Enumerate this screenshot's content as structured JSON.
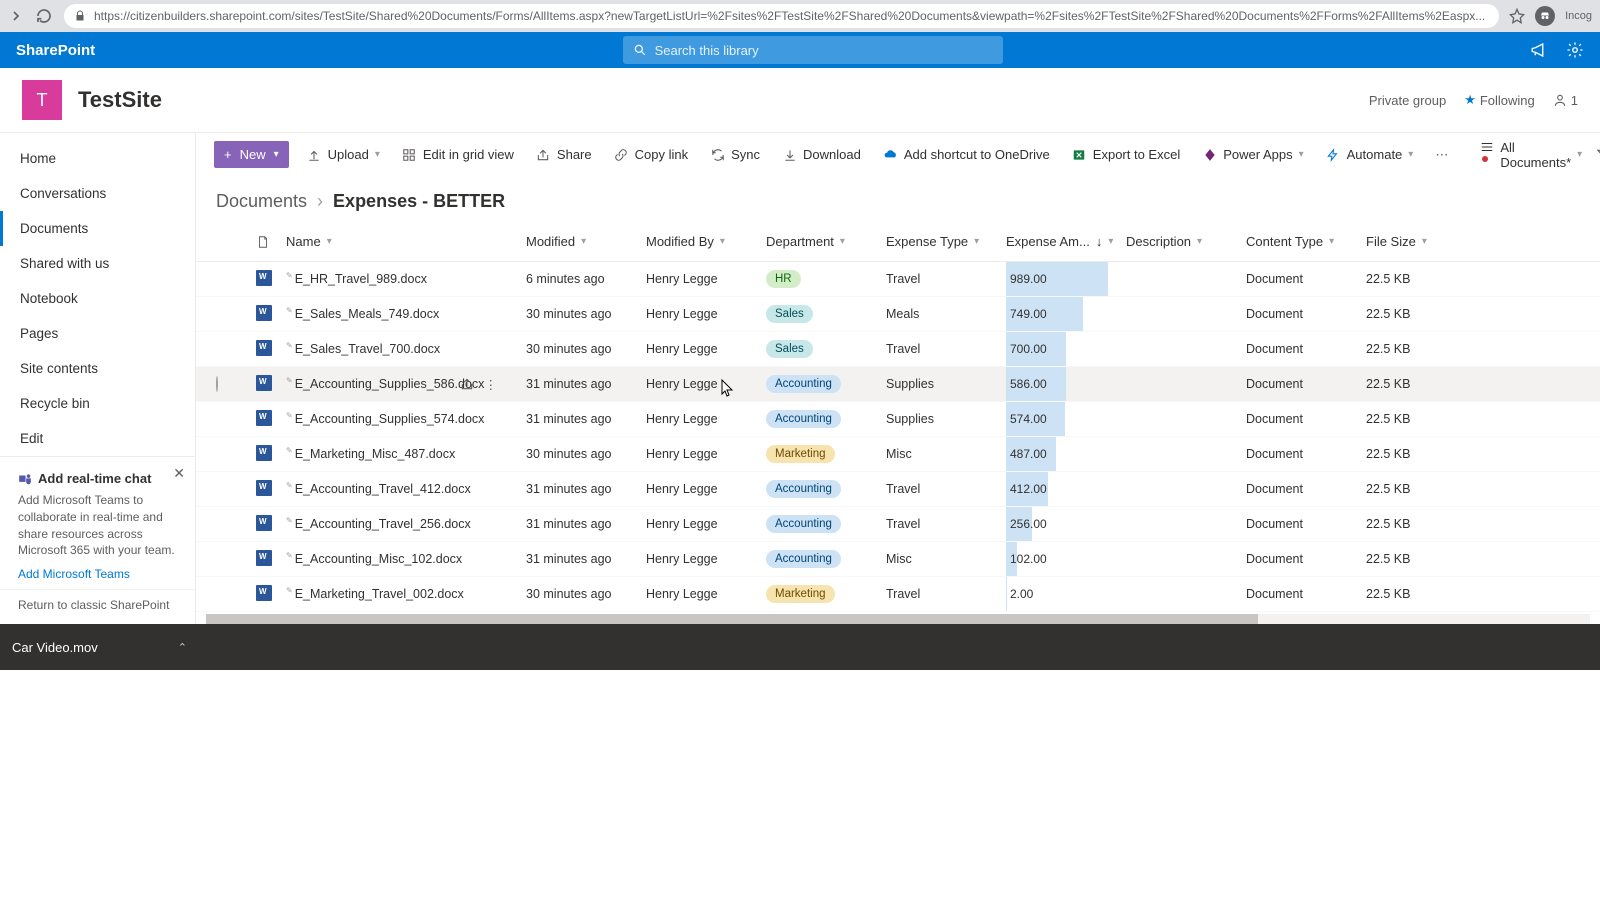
{
  "browser": {
    "url": "https://citizenbuilders.sharepoint.com/sites/TestSite/Shared%20Documents/Forms/AllItems.aspx?newTargetListUrl=%2Fsites%2FTestSite%2FShared%20Documents&viewpath=%2Fsites%2FTestSite%2FShared%20Documents%2FForms%2FAllItems%2Easpx...",
    "incognito_label": "Incog"
  },
  "suite": {
    "brand": "SharePoint",
    "search_placeholder": "Search this library"
  },
  "site": {
    "logo_letter": "T",
    "title": "TestSite",
    "group_type": "Private group",
    "following": "Following",
    "members": "1"
  },
  "nav": {
    "items": [
      "Home",
      "Conversations",
      "Documents",
      "Shared with us",
      "Notebook",
      "Pages",
      "Site contents",
      "Recycle bin",
      "Edit"
    ],
    "active_index": 2
  },
  "teams_card": {
    "title": "Add real-time chat",
    "body": "Add Microsoft Teams to collaborate in real-time and share resources across Microsoft 365 with your team.",
    "link": "Add Microsoft Teams"
  },
  "return_link": "Return to classic SharePoint",
  "cmd": {
    "new": "New",
    "upload": "Upload",
    "edit_grid": "Edit in grid view",
    "share": "Share",
    "copy_link": "Copy link",
    "sync": "Sync",
    "download": "Download",
    "shortcut": "Add shortcut to OneDrive",
    "export": "Export to Excel",
    "power_apps": "Power Apps",
    "automate": "Automate",
    "view_name": "All Documents*"
  },
  "breadcrumb": {
    "root": "Documents",
    "leaf": "Expenses - BETTER"
  },
  "columns": {
    "name": "Name",
    "modified": "Modified",
    "modified_by": "Modified By",
    "department": "Department",
    "expense_type": "Expense Type",
    "expense_amount": "Expense Am...",
    "description": "Description",
    "content_type": "Content Type",
    "file_size": "File Size"
  },
  "max_amount": 989.0,
  "rows": [
    {
      "name": "E_HR_Travel_989.docx",
      "modified": "6 minutes ago",
      "modified_by": "Henry Legge",
      "dept": "HR",
      "dept_class": "pill-hr",
      "exp_type": "Travel",
      "amount": "989.00",
      "ctype": "Document",
      "size": "22.5 KB",
      "bar_pct": 85
    },
    {
      "name": "E_Sales_Meals_749.docx",
      "modified": "30 minutes ago",
      "modified_by": "Henry Legge",
      "dept": "Sales",
      "dept_class": "pill-sales",
      "exp_type": "Meals",
      "amount": "749.00",
      "ctype": "Document",
      "size": "22.5 KB",
      "bar_pct": 64
    },
    {
      "name": "E_Sales_Travel_700.docx",
      "modified": "30 minutes ago",
      "modified_by": "Henry Legge",
      "dept": "Sales",
      "dept_class": "pill-sales",
      "exp_type": "Travel",
      "amount": "700.00",
      "ctype": "Document",
      "size": "22.5 KB",
      "bar_pct": 50
    },
    {
      "name": "E_Accounting_Supplies_586.docx",
      "modified": "31 minutes ago",
      "modified_by": "Henry Legge",
      "dept": "Accounting",
      "dept_class": "pill-acc",
      "exp_type": "Supplies",
      "amount": "586.00",
      "ctype": "Document",
      "size": "22.5 KB",
      "bar_pct": 50,
      "hovered": true
    },
    {
      "name": "E_Accounting_Supplies_574.docx",
      "modified": "31 minutes ago",
      "modified_by": "Henry Legge",
      "dept": "Accounting",
      "dept_class": "pill-acc",
      "exp_type": "Supplies",
      "amount": "574.00",
      "ctype": "Document",
      "size": "22.5 KB",
      "bar_pct": 49
    },
    {
      "name": "E_Marketing_Misc_487.docx",
      "modified": "30 minutes ago",
      "modified_by": "Henry Legge",
      "dept": "Marketing",
      "dept_class": "pill-mkt",
      "exp_type": "Misc",
      "amount": "487.00",
      "ctype": "Document",
      "size": "22.5 KB",
      "bar_pct": 42
    },
    {
      "name": "E_Accounting_Travel_412.docx",
      "modified": "31 minutes ago",
      "modified_by": "Henry Legge",
      "dept": "Accounting",
      "dept_class": "pill-acc",
      "exp_type": "Travel",
      "amount": "412.00",
      "ctype": "Document",
      "size": "22.5 KB",
      "bar_pct": 35
    },
    {
      "name": "E_Accounting_Travel_256.docx",
      "modified": "31 minutes ago",
      "modified_by": "Henry Legge",
      "dept": "Accounting",
      "dept_class": "pill-acc",
      "exp_type": "Travel",
      "amount": "256.00",
      "ctype": "Document",
      "size": "22.5 KB",
      "bar_pct": 22
    },
    {
      "name": "E_Accounting_Misc_102.docx",
      "modified": "31 minutes ago",
      "modified_by": "Henry Legge",
      "dept": "Accounting",
      "dept_class": "pill-acc",
      "exp_type": "Misc",
      "amount": "102.00",
      "ctype": "Document",
      "size": "22.5 KB",
      "bar_pct": 9
    },
    {
      "name": "E_Marketing_Travel_002.docx",
      "modified": "30 minutes ago",
      "modified_by": "Henry Legge",
      "dept": "Marketing",
      "dept_class": "pill-mkt",
      "exp_type": "Travel",
      "amount": "2.00",
      "ctype": "Document",
      "size": "22.5 KB",
      "bar_pct": 1
    }
  ],
  "download_bar": {
    "file": "Car Video.mov"
  }
}
